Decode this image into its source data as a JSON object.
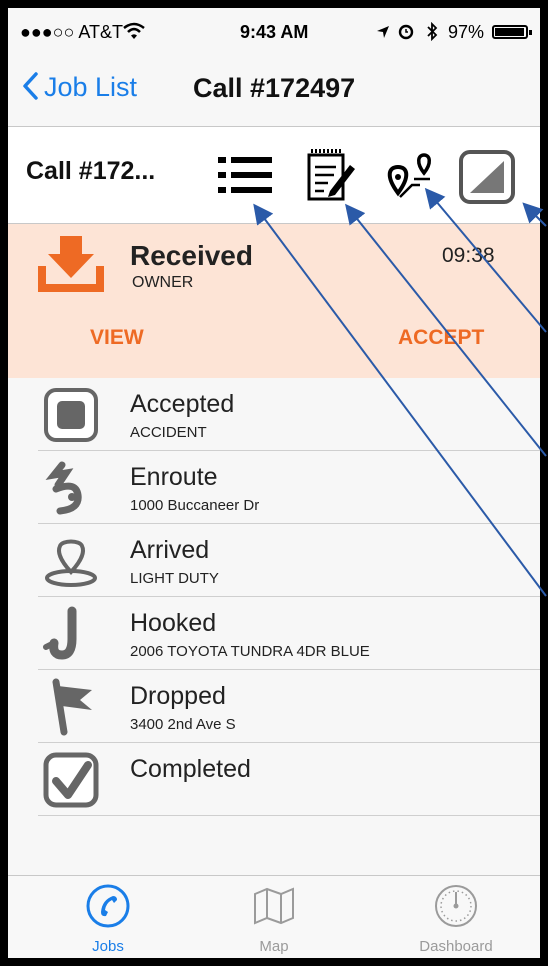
{
  "status_bar": {
    "carrier": "●●●○○ AT&T",
    "time": "9:43 AM",
    "battery": "97%",
    "battery_level": 0.97
  },
  "nav": {
    "back_label": "Job List",
    "title": "Call #172497"
  },
  "toolbar": {
    "call_label": "Call #172...",
    "icons": [
      "list-icon",
      "notes-icon",
      "route-icon",
      "status-icon"
    ]
  },
  "received": {
    "title": "Received",
    "subtitle": "OWNER",
    "time": "09:38",
    "view_label": "VIEW",
    "accept_label": "ACCEPT",
    "accent_color": "#ee6a24"
  },
  "statuses": [
    {
      "title": "Accepted",
      "subtitle": "ACCIDENT",
      "icon": "accepted-square-icon"
    },
    {
      "title": "Enroute",
      "subtitle": "1000 Buccaneer Dr",
      "icon": "enroute-icon"
    },
    {
      "title": "Arrived",
      "subtitle": "LIGHT DUTY",
      "icon": "arrived-pin-icon"
    },
    {
      "title": "Hooked",
      "subtitle": "2006 TOYOTA TUNDRA 4DR BLUE",
      "icon": "hook-icon"
    },
    {
      "title": "Dropped",
      "subtitle": "3400 2nd Ave S",
      "icon": "flag-icon"
    },
    {
      "title": "Completed",
      "subtitle": "",
      "icon": "checkbox-icon"
    }
  ],
  "tabs": [
    {
      "label": "Jobs",
      "icon": "phone-icon",
      "active": true,
      "color": "#1a7ee8"
    },
    {
      "label": "Map",
      "icon": "map-icon",
      "active": false,
      "color": "#9b9b9b"
    },
    {
      "label": "Dashboard",
      "icon": "gauge-icon",
      "active": false,
      "color": "#9b9b9b"
    }
  ]
}
